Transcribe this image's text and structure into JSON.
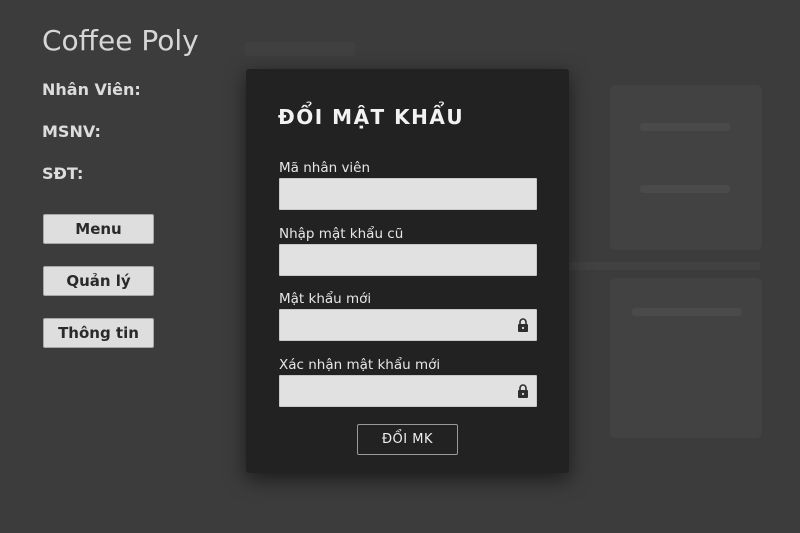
{
  "app": {
    "title": "Coffee Poly"
  },
  "employee_info": {
    "name_label": "Nhân Viên:",
    "id_label": "MSNV:",
    "phone_label": "SĐT:"
  },
  "sidebar": {
    "buttons": [
      {
        "label": "Menu"
      },
      {
        "label": "Quản lý"
      },
      {
        "label": "Thông tin"
      }
    ]
  },
  "dialog": {
    "title": "ĐỔI MẬT KHẨU",
    "fields": [
      {
        "label": "Mã nhân viên",
        "value": "",
        "type": "text"
      },
      {
        "label": "Nhập mật khẩu cũ",
        "value": "",
        "type": "password"
      },
      {
        "label": "Mật khẩu mới",
        "value": "",
        "type": "password",
        "icon": "lock-icon"
      },
      {
        "label": "Xác nhận mật khẩu mới",
        "value": "",
        "type": "password",
        "icon": "lock-icon"
      }
    ],
    "submit_label": "ĐỔI MK"
  },
  "colors": {
    "background": "#3c3c3c",
    "dialog_bg": "#222222",
    "field_bg": "#e1e1e1",
    "sidebar_button_bg": "#dedede"
  }
}
